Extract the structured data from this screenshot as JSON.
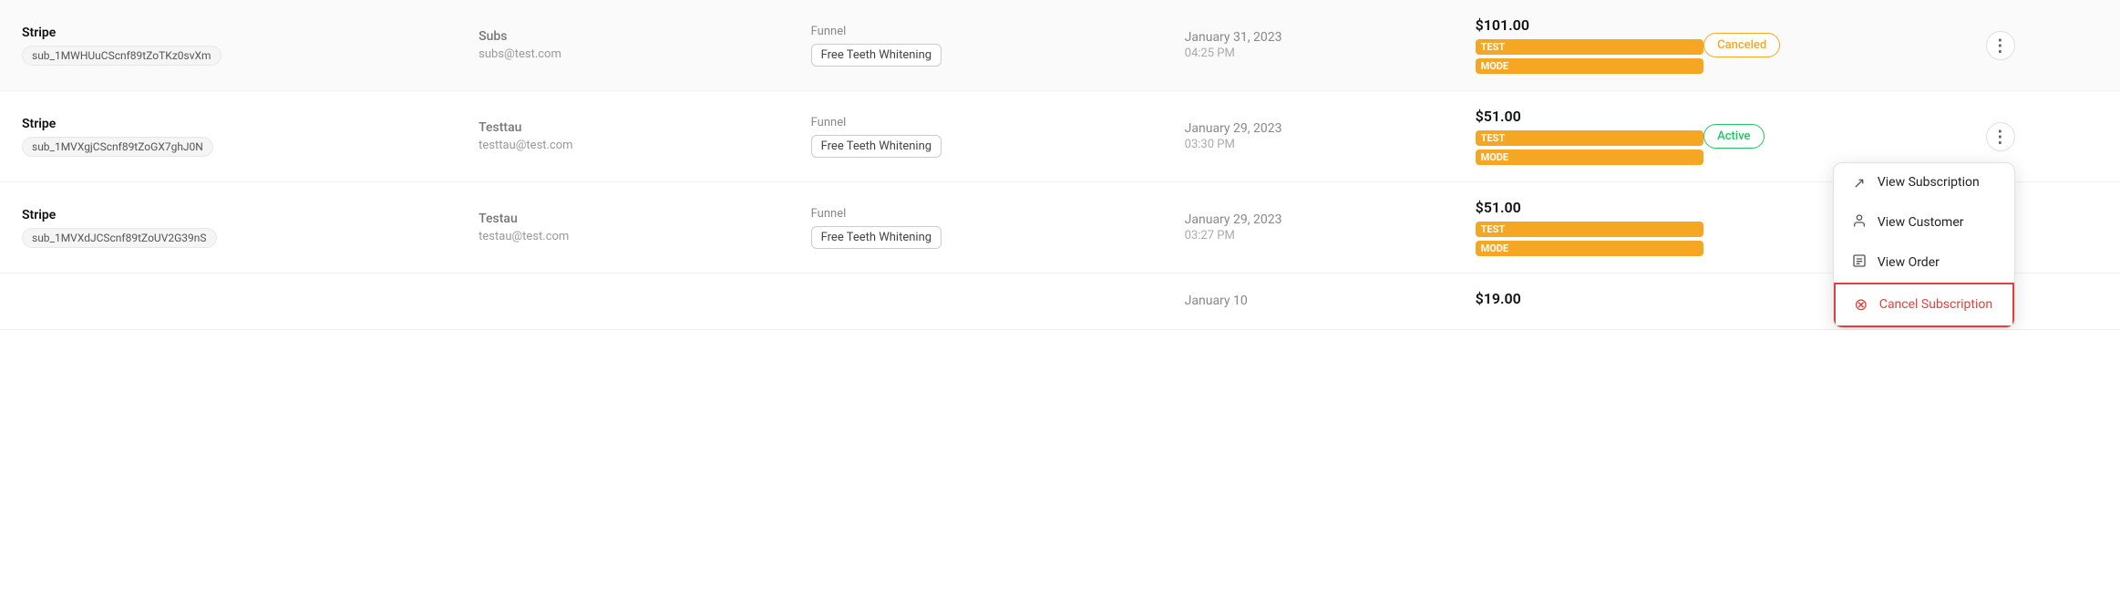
{
  "rows": [
    {
      "id": "row-1",
      "provider": "Stripe",
      "sub_id": "sub_1MWHUuCScnf89tZoTKz0svXm",
      "customer_name": "Subs",
      "customer_email": "subs@test.com",
      "funnel_label": "Funnel",
      "funnel_name": "Free Teeth Whitening",
      "date": "January 31, 2023",
      "time": "04:25 PM",
      "amount": "$101.00",
      "test_label": "TEST",
      "mode_label": "MODE",
      "status": "Canceled",
      "status_type": "canceled",
      "show_menu": false
    },
    {
      "id": "row-2",
      "provider": "Stripe",
      "sub_id": "sub_1MVXgjCScnf89tZoGX7ghJ0N",
      "customer_name": "Testtau",
      "customer_email": "testtau@test.com",
      "funnel_label": "Funnel",
      "funnel_name": "Free Teeth Whitening",
      "date": "January 29, 2023",
      "time": "03:30 PM",
      "amount": "$51.00",
      "test_label": "TEST",
      "mode_label": "MODE",
      "status": "Active",
      "status_type": "active",
      "show_menu": true
    },
    {
      "id": "row-3",
      "provider": "Stripe",
      "sub_id": "sub_1MVXdJCScnf89tZoUV2G39nS",
      "customer_name": "Testau",
      "customer_email": "testau@test.com",
      "funnel_label": "Funnel",
      "funnel_name": "Free Teeth Whitening",
      "date": "January 29, 2023",
      "time": "03:27 PM",
      "amount": "$51.00",
      "test_label": "TEST",
      "mode_label": "MODE",
      "status": "",
      "status_type": "none",
      "show_menu": false
    },
    {
      "id": "row-4",
      "provider": "",
      "sub_id": "",
      "customer_name": "",
      "customer_email": "",
      "funnel_label": "",
      "funnel_name": "",
      "date": "January 10",
      "time": "",
      "amount": "$19.00",
      "test_label": "",
      "mode_label": "",
      "status": "",
      "status_type": "none",
      "show_menu": false,
      "partial": true
    }
  ],
  "dropdown_menu": {
    "items": [
      {
        "id": "view-subscription",
        "icon": "↗",
        "icon_name": "external-link-icon",
        "label": "View Subscription",
        "danger": false
      },
      {
        "id": "view-customer",
        "icon": "👤",
        "icon_name": "person-icon",
        "label": "View Customer",
        "danger": false
      },
      {
        "id": "view-order",
        "icon": "🗒",
        "icon_name": "order-icon",
        "label": "View Order",
        "danger": false
      },
      {
        "id": "cancel-subscription",
        "icon": "⊗",
        "icon_name": "cancel-icon",
        "label": "Cancel Subscription",
        "danger": true
      }
    ]
  }
}
